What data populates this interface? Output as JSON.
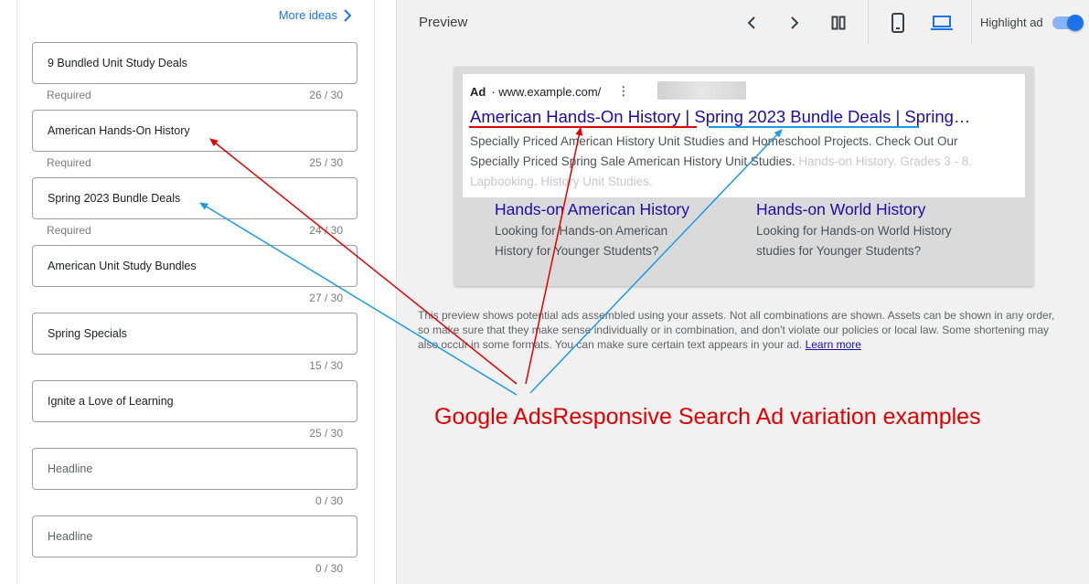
{
  "left": {
    "more_ideas": "More ideas",
    "fields": [
      {
        "value": "9 Bundled Unit Study Deals",
        "required": "Required",
        "count": "26 / 30"
      },
      {
        "value": "American Hands-On History",
        "required": "Required",
        "count": "25 / 30"
      },
      {
        "value": "Spring 2023 Bundle Deals",
        "required": "Required",
        "count": "24 / 30"
      },
      {
        "value": "American Unit Study Bundles",
        "required": "",
        "count": "27 / 30"
      },
      {
        "value": "Spring Specials",
        "required": "",
        "count": "15 / 30"
      },
      {
        "value": "Ignite a Love of Learning",
        "required": "",
        "count": "25 / 30"
      },
      {
        "value": "",
        "placeholder": "Headline",
        "required": "",
        "count": "0 / 30"
      },
      {
        "value": "",
        "placeholder": "Headline",
        "required": "",
        "count": "0 / 30"
      }
    ]
  },
  "preview": {
    "title": "Preview",
    "highlight_label": "Highlight ad",
    "highlight_on": true,
    "icons": [
      "chevron-left-icon",
      "chevron-right-icon",
      "columns-icon",
      "mobile-icon",
      "desktop-icon"
    ]
  },
  "ad": {
    "label": "Ad",
    "url": "· www.example.com/",
    "menu": "⋮",
    "headline": "American Hands-On History | Spring 2023 Bundle Deals | Spring…",
    "description": "Specially Priced American History Unit Studies and Homeschool Projects. Check Out Our Specially Priced Spring Sale American History Unit Studies.",
    "description_faded": "Hands-on History. Grades 3 - 8. Lapbooking. History Unit Studies.",
    "sitelinks": [
      {
        "title": "Hands-on American History",
        "desc": "Looking for Hands-on American History for Younger Students?"
      },
      {
        "title": "Hands-on World History",
        "desc": "Looking for Hands-on World History studies for Younger Students?"
      }
    ]
  },
  "disclaimer": {
    "text": "This preview shows potential ads assembled using your assets. Not all combinations are shown. Assets can be shown in any order, so make sure that they make sense individually or in combination, and don't violate our policies or local law. Some shortening may also occur in some formats. You can make sure certain text appears in your ad.",
    "link": "Learn more"
  },
  "annotation": {
    "caption": "Google AdsResponsive Search Ad variation examples",
    "red": "#e00000",
    "blue": "#1a9be6"
  },
  "colors": {
    "accent": "#1a73e8",
    "ad_link": "#1a0dab"
  }
}
